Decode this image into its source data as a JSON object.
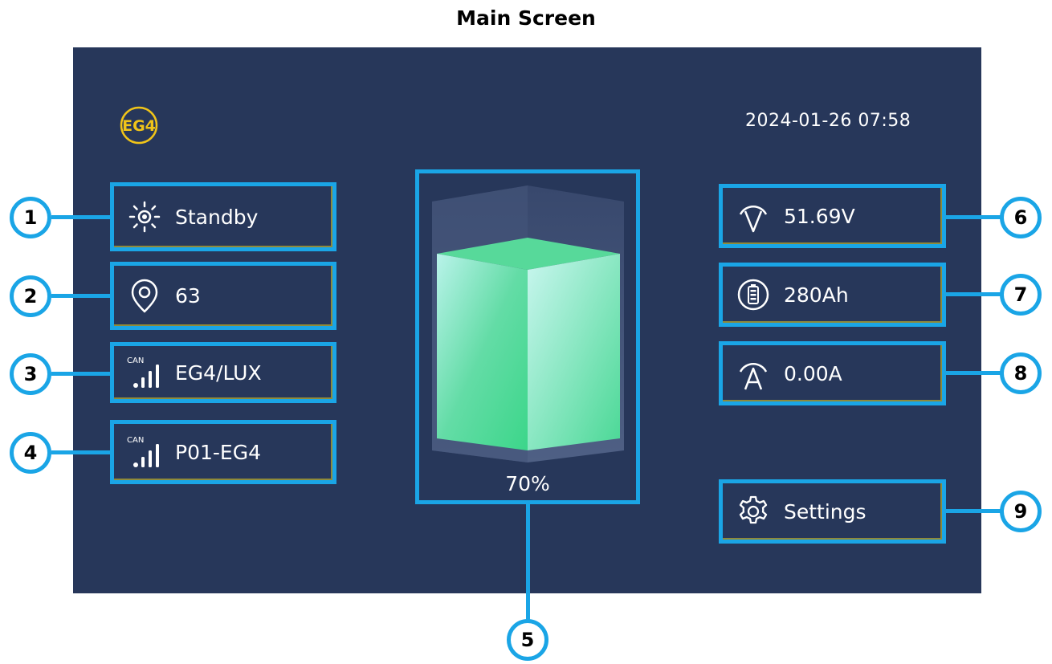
{
  "page_title": "Main Screen",
  "brand": {
    "logo_text": "EG4",
    "accent_color": "#f0c419"
  },
  "datetime": "2024-01-26  07:58",
  "left_panel": {
    "status": {
      "label": "Standby",
      "icon": "sun-icon"
    },
    "soh": {
      "label": "63",
      "icon": "location-pin-icon"
    },
    "can_protocol": {
      "label": "EG4/LUX",
      "icon": "can-signal-icon",
      "badge": "CAN"
    },
    "rs485_protocol": {
      "label": "P01-EG4",
      "icon": "can-signal-icon",
      "badge": "CAN"
    }
  },
  "battery": {
    "state_of_charge": "70%",
    "fill_fraction": 0.7,
    "fill_color": "#3cd68a"
  },
  "right_panel": {
    "voltage": {
      "label": "51.69V",
      "icon": "voltage-icon"
    },
    "capacity": {
      "label": "280Ah",
      "icon": "battery-capacity-icon"
    },
    "current": {
      "label": "0.00A",
      "icon": "current-icon"
    },
    "settings": {
      "label": "Settings",
      "icon": "gear-icon"
    }
  },
  "callouts": [
    "1",
    "2",
    "3",
    "4",
    "5",
    "6",
    "7",
    "8",
    "9"
  ],
  "colors": {
    "screen_bg": "#27375a",
    "highlight": "#1aa5e6"
  }
}
